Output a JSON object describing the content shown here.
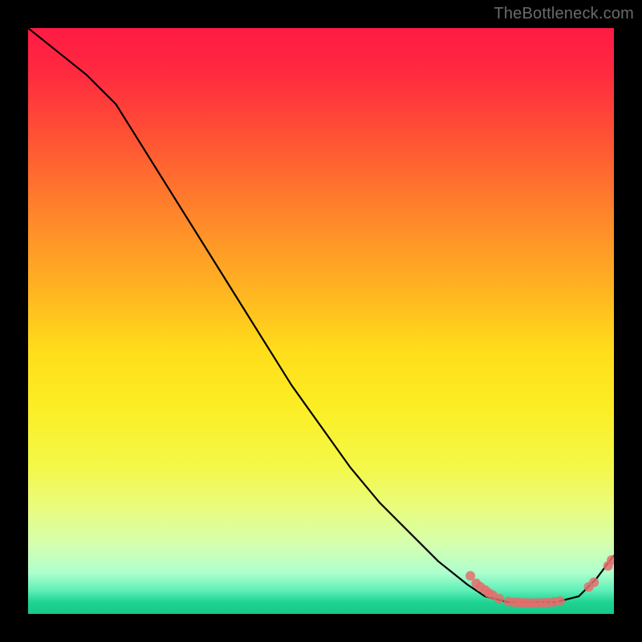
{
  "watermark": "TheBottleneck.com",
  "chart_data": {
    "type": "line",
    "title": "",
    "xlabel": "",
    "ylabel": "",
    "xlim": [
      0,
      100
    ],
    "ylim": [
      0,
      100
    ],
    "grid": false,
    "legend": false,
    "series": [
      {
        "name": "bottleneck-curve",
        "color": "#000000",
        "x": [
          0,
          5,
          10,
          15,
          20,
          25,
          30,
          35,
          40,
          45,
          50,
          55,
          60,
          65,
          70,
          75,
          78,
          82,
          86,
          90,
          94,
          97,
          100
        ],
        "y": [
          100,
          96,
          92,
          87,
          79,
          71,
          63,
          55,
          47,
          39,
          32,
          25,
          19,
          14,
          9,
          5,
          3,
          2,
          2,
          2,
          3,
          6,
          10
        ]
      }
    ],
    "scatter_points": {
      "name": "sample-dots",
      "color": "#e46d6d",
      "radius": 6,
      "points": [
        {
          "x": 75.5,
          "y": 6.5
        },
        {
          "x": 76.5,
          "y": 5.2
        },
        {
          "x": 77.2,
          "y": 4.6
        },
        {
          "x": 78.0,
          "y": 4.1
        },
        {
          "x": 78.6,
          "y": 3.6
        },
        {
          "x": 79.3,
          "y": 3.2
        },
        {
          "x": 80.4,
          "y": 2.6
        },
        {
          "x": 82.0,
          "y": 2.1
        },
        {
          "x": 83.0,
          "y": 2.0
        },
        {
          "x": 83.8,
          "y": 1.95
        },
        {
          "x": 84.5,
          "y": 1.9
        },
        {
          "x": 85.3,
          "y": 1.88
        },
        {
          "x": 86.1,
          "y": 1.87
        },
        {
          "x": 87.0,
          "y": 1.88
        },
        {
          "x": 87.9,
          "y": 1.9
        },
        {
          "x": 88.8,
          "y": 1.95
        },
        {
          "x": 89.8,
          "y": 2.05
        },
        {
          "x": 90.8,
          "y": 2.2
        },
        {
          "x": 95.7,
          "y": 4.6
        },
        {
          "x": 96.6,
          "y": 5.4
        },
        {
          "x": 99.0,
          "y": 8.2
        },
        {
          "x": 99.6,
          "y": 9.2
        }
      ]
    }
  }
}
